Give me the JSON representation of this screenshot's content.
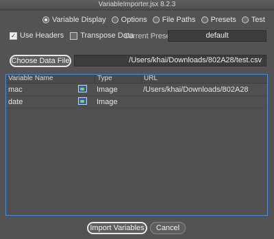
{
  "window": {
    "title": "VariableImporter.jsx 8.2.3"
  },
  "tabs": [
    {
      "label": "Variable Display",
      "selected": true
    },
    {
      "label": "Options",
      "selected": false
    },
    {
      "label": "File Paths",
      "selected": false
    },
    {
      "label": "Presets",
      "selected": false
    },
    {
      "label": "Test",
      "selected": false
    }
  ],
  "options": {
    "use_headers": {
      "label": "Use Headers",
      "checked": true
    },
    "transpose": {
      "label": "Transpose Data",
      "checked": false
    }
  },
  "preset": {
    "label": "Current Preset",
    "value": "default"
  },
  "data_file": {
    "button_label": "Choose Data File",
    "path": "/Users/khai/Downloads/802A28/test.csv"
  },
  "table": {
    "headers": [
      "Variable Name",
      "",
      "Type",
      "URL"
    ],
    "rows": [
      {
        "name": "mac",
        "icon": "image-thumbnail-icon",
        "type": "Image",
        "url": "/Users/khai/Downloads/802A28"
      },
      {
        "name": "date",
        "icon": "image-thumbnail-icon",
        "type": "Image",
        "url": ""
      }
    ]
  },
  "footer": {
    "import_label": "Import Variables",
    "cancel_label": "Cancel"
  }
}
